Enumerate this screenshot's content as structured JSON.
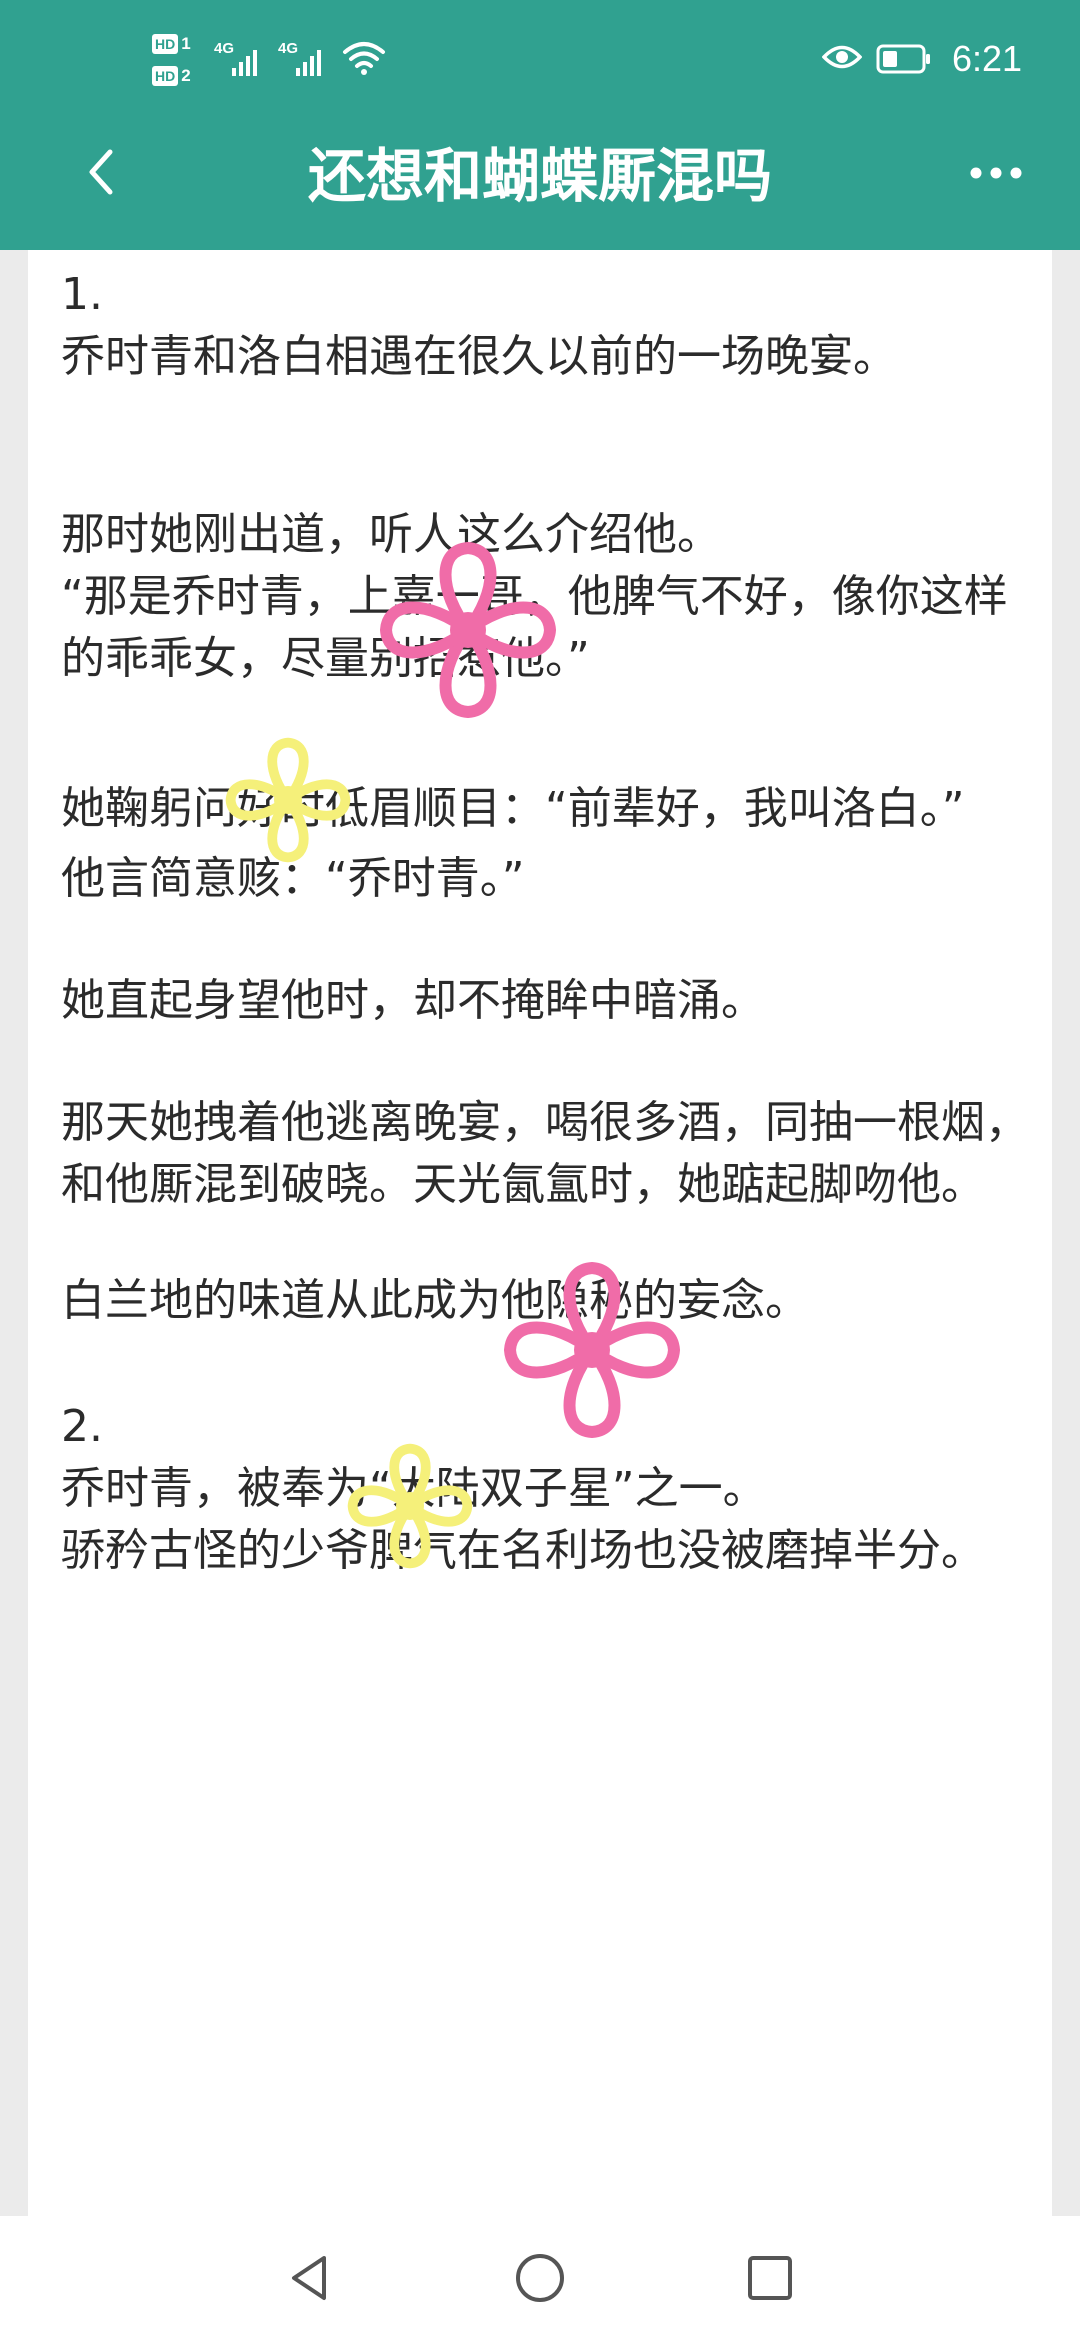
{
  "status_bar": {
    "hd1": "HD",
    "hd1_num": "1",
    "hd2": "HD",
    "hd2_num": "2",
    "network1": "4G",
    "network2": "4G",
    "time": "6:21"
  },
  "title_bar": {
    "title": "还想和蝴蝶厮混吗"
  },
  "article": {
    "paragraphs": [
      "1.",
      "乔时青和洛白相遇在很久以前的一场晚宴。",
      "那时她刚出道，听人这么介绍他。",
      "“那是乔时青，上嘉一哥，他脾气不好，像你这样的乖乖女，尽量别招惹他。”",
      "她鞠躬问好时低眉顺目：“前辈好，我叫洛白。”",
      "他言简意赅：“乔时青。”",
      "她直起身望他时，却不掩眸中暗涌。",
      "那天她拽着他逃离晚宴，喝很多酒，同抽一根烟，和他厮混到破晓。天光氤氲时，她踮起脚吻他。",
      "白兰地的味道从此成为他隐秘的妄念。",
      "2.",
      "乔时青，被奉为“大陆双子星”之一。",
      "骄矜古怪的少爷脾气在名利场也没被磨掉半分。"
    ]
  },
  "colors": {
    "header_bg": "#30a190",
    "header_text": "#ffffff",
    "text": "#2b2b2b",
    "page_bg": "#ebebeb",
    "flower_pink": "#f06ca8",
    "flower_yellow": "#f5f07a"
  },
  "icons": {
    "back": "chevron-left-icon",
    "more": "more-horizontal-icon",
    "wifi": "wifi-icon",
    "eye": "eye-icon",
    "battery": "battery-icon",
    "nav_back": "triangle-back-icon",
    "nav_home": "circle-home-icon",
    "nav_recent": "square-recent-icon"
  }
}
